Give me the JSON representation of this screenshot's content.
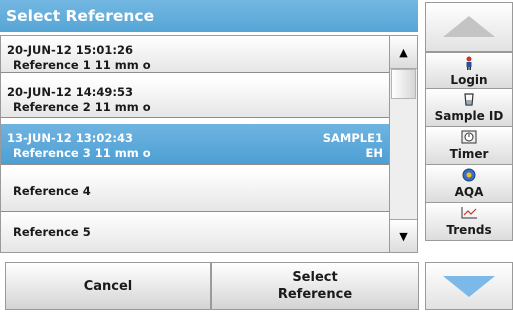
{
  "title": "Select Reference",
  "references": [
    {
      "line1": "20-JUN-12  15:01:26",
      "line2": "Reference 1  11 mm o",
      "right1": "",
      "right2": "",
      "selected": false
    },
    {
      "line1": "20-JUN-12  14:49:53",
      "line2": "Reference 2  11 mm o",
      "right1": "",
      "right2": "",
      "selected": false
    },
    {
      "line1": "13-JUN-12  13:02:43",
      "line2": "Reference 3  11 mm o",
      "right1": "SAMPLE1",
      "right2": "EH",
      "selected": true
    },
    {
      "single": "Reference 4"
    },
    {
      "single": "Reference 5"
    }
  ],
  "buttons": {
    "cancel": "Cancel",
    "select_line1": "Select",
    "select_line2": "Reference"
  },
  "sidebar": {
    "items": [
      {
        "label": "Login",
        "icon": "person-icon"
      },
      {
        "label": "Sample ID",
        "icon": "sample-id-icon"
      },
      {
        "label": "Timer",
        "icon": "timer-icon"
      },
      {
        "label": "AQA",
        "icon": "aqa-icon"
      },
      {
        "label": "Trends",
        "icon": "trends-icon"
      }
    ]
  },
  "colors": {
    "accent": "#5aa8d9",
    "arrow": "#7cb9e8"
  }
}
